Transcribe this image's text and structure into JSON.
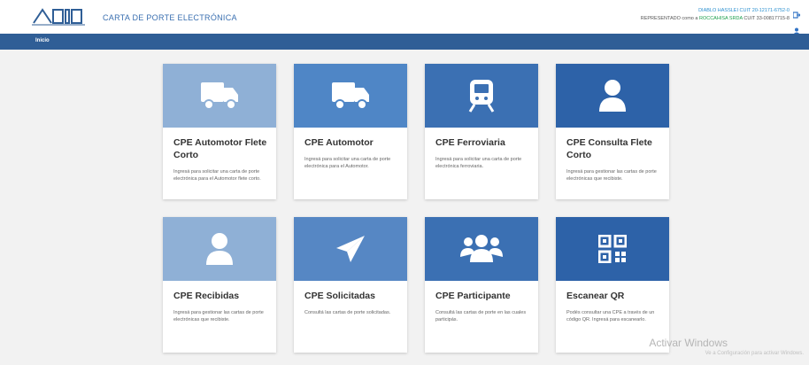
{
  "header": {
    "logo_text": "AFIP",
    "app_title": "CARTA DE PORTE ELECTRÓNICA",
    "user_line1": "DIABLO HASSLEI CUIT 20-12171-6752-0",
    "user_line2_prefix": "REPRESENTADO como a",
    "user_line2_hl": "ROCCAHISA SRDA",
    "user_line2_suffix": "CUIT 33-00817715-8"
  },
  "nav": {
    "home_label": "Inicio"
  },
  "cards": [
    {
      "title": "CPE Automotor Flete Corto",
      "desc": "Ingresá para solicitar una carta de porte electrónica para el Automotor flete corto.",
      "icon": "truck-icon",
      "color": "#8fb0d6"
    },
    {
      "title": "CPE Automotor",
      "desc": "Ingresá para solicitar una carta de porte electrónica para el Automotor.",
      "icon": "truck-icon",
      "color": "#4f86c6"
    },
    {
      "title": "CPE Ferroviaria",
      "desc": "Ingresá para solicitar una carta de porte electrónica ferroviaria.",
      "icon": "train-icon",
      "color": "#3b70b3"
    },
    {
      "title": "CPE Consulta Flete Corto",
      "desc": "Ingresá para gestionar las cartas de porte electrónicas que recibiste.",
      "icon": "user-icon",
      "color": "#2d62a8"
    },
    {
      "title": "CPE Recibidas",
      "desc": "Ingresá para gestionar las cartas de porte electrónicas que recibiste.",
      "icon": "user-icon",
      "color": "#8fb0d6"
    },
    {
      "title": "CPE Solicitadas",
      "desc": "Consultá las cartas de porte solicitadas.",
      "icon": "paper-plane-icon",
      "color": "#5687c4"
    },
    {
      "title": "CPE Participante",
      "desc": "Consultá las cartas de porte en las cuales participás.",
      "icon": "group-icon",
      "color": "#3b70b3"
    },
    {
      "title": "Escanear QR",
      "desc": "Podés consultar una CPE a través de un código QR. Ingresá para escanearlo.",
      "icon": "qr-code-icon",
      "color": "#2d62a8"
    }
  ],
  "watermark": {
    "title": "Activar Windows",
    "subtitle": "Ve a Configuración para activar Windows."
  }
}
